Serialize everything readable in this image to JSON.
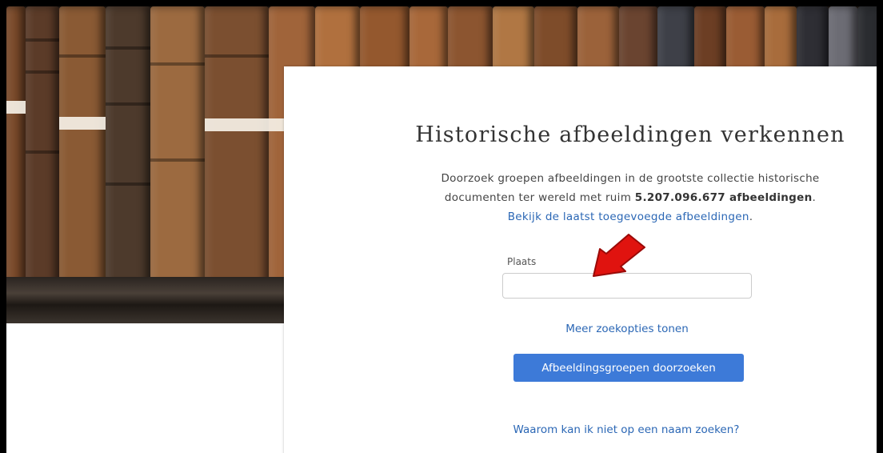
{
  "hero": {
    "image_description": "bookshelf-photo"
  },
  "card": {
    "title": "Historische afbeeldingen verkennen",
    "description_prefix": "Doorzoek groepen afbeeldingen in de grootste collectie historische documenten ter wereld met ruim ",
    "description_count": "5.207.096.677 afbeeldingen",
    "description_suffix": ".",
    "recent_link": "Bekijk de laatst toegevoegde afbeeldingen",
    "recent_link_suffix": ".",
    "place_label": "Plaats",
    "place_value": "",
    "more_options_link": "Meer zoekopties tonen",
    "search_button": "Afbeeldingsgroepen doorzoeken",
    "why_link": "Waarom kan ik niet op een naam zoeken?"
  },
  "colors": {
    "link": "#2b67b5",
    "button": "#3d7ad8",
    "annotation_arrow": "#e0130f"
  }
}
